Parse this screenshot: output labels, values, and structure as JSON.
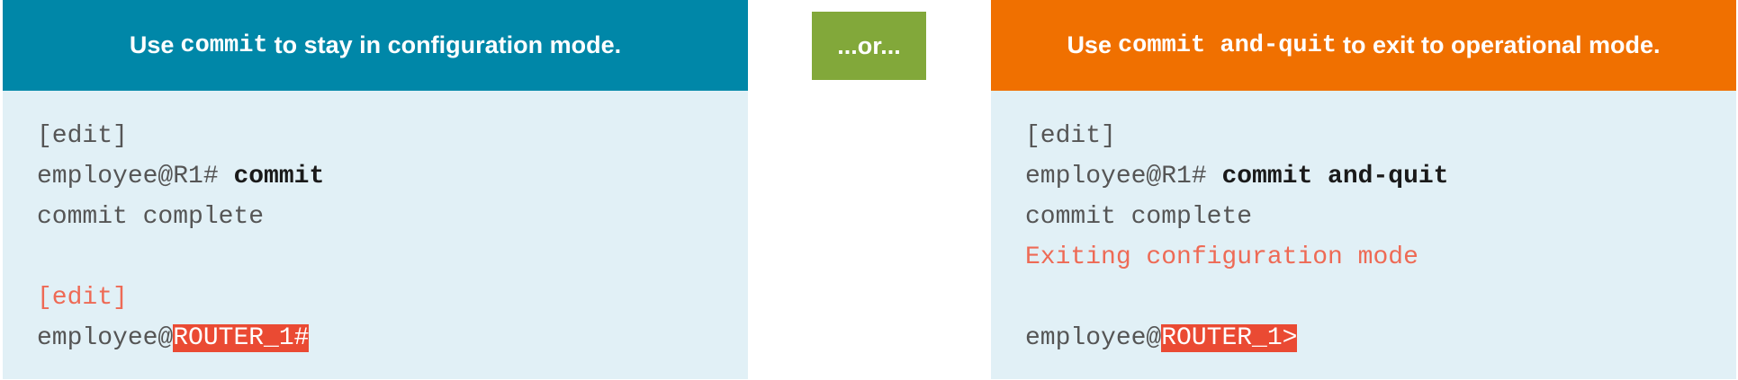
{
  "left_panel": {
    "header": {
      "prefix": "Use",
      "code": "commit",
      "suffix": "to stay in configuration mode."
    },
    "lines": {
      "l1": "[edit]",
      "l2_prompt": "employee@R1# ",
      "l2_cmd": "commit",
      "l3": "commit complete",
      "l5": "[edit]",
      "l6_user": "employee@",
      "l6_host": "ROUTER_1#"
    }
  },
  "or_badge": "...or...",
  "right_panel": {
    "header": {
      "prefix": "Use",
      "code": "commit and-quit",
      "suffix": "to exit to operational mode."
    },
    "lines": {
      "l1": "[edit]",
      "l2_prompt": "employee@R1# ",
      "l2_cmd": "commit and-quit",
      "l3": "commit complete",
      "l4": "Exiting configuration mode",
      "l6_user": "employee@",
      "l6_host": "ROUTER_1>"
    }
  },
  "colors": {
    "left_header": "#0087a8",
    "right_header": "#f07000",
    "or_badge": "#82a83a",
    "panel_body": "#e1f0f6",
    "highlight_text": "#ee6a55",
    "prompt_box": "#ea4a33"
  }
}
